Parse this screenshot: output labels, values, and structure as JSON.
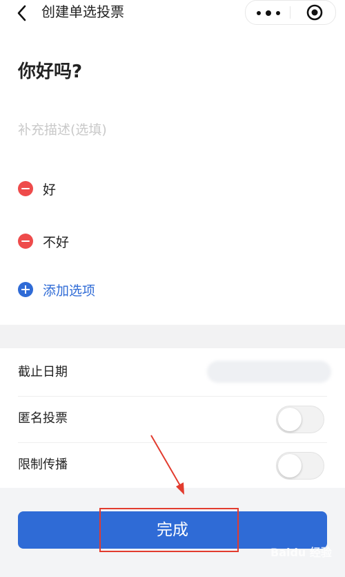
{
  "header": {
    "title": "创建单选投票",
    "back_icon": "chevron-left-icon",
    "more_icon": "more-dots-icon",
    "target_icon": "record-target-icon"
  },
  "poll": {
    "question": "你好吗?",
    "description_placeholder": "补充描述(选填)",
    "options": [
      "好",
      "不好"
    ],
    "add_option_label": "添加选项"
  },
  "settings": {
    "deadline_label": "截止日期",
    "anonymous_label": "匿名投票",
    "anonymous_on": false,
    "restrict_label": "限制传播",
    "restrict_on": false
  },
  "actions": {
    "done_label": "完成"
  },
  "colors": {
    "primary": "#2f6bd6",
    "delete": "#ee4b4b",
    "annotation": "#e23b2e"
  },
  "watermark": "Baidu 经验"
}
